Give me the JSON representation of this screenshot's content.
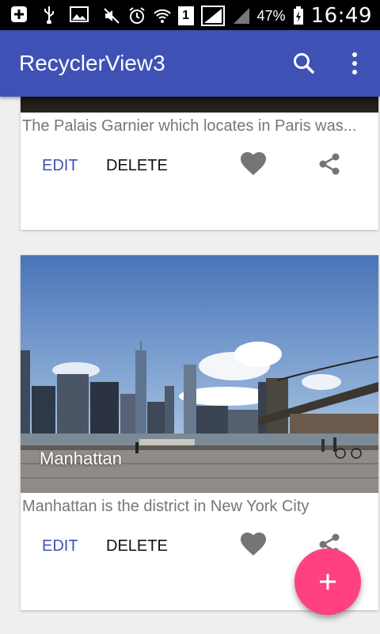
{
  "status_bar": {
    "battery_percent": "47%",
    "time": "16:49",
    "sim_badge": "1"
  },
  "app_bar": {
    "title": "RecyclerView3",
    "color": "#3f51b5"
  },
  "cards": [
    {
      "caption": "",
      "description": "The Palais Garnier which locates in Paris was...",
      "edit_label": "EDIT",
      "delete_label": "DELETE"
    },
    {
      "caption": "Manhattan",
      "description": "Manhattan is the district in New York City",
      "edit_label": "EDIT",
      "delete_label": "DELETE"
    }
  ],
  "fab": {
    "icon": "plus-icon",
    "color": "#ff4081"
  },
  "accent_color": "#3f51b5"
}
